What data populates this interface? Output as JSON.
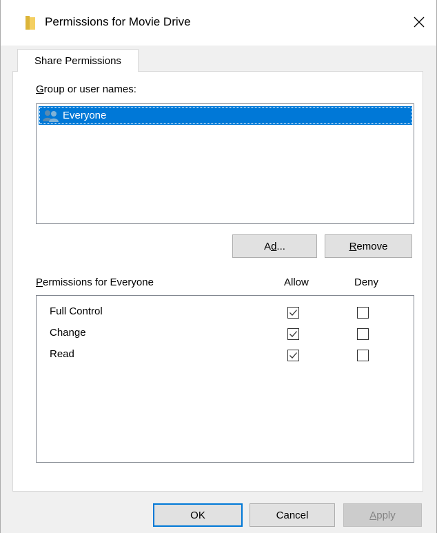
{
  "window": {
    "title": "Permissions for Movie Drive"
  },
  "tab": {
    "label": "Share Permissions"
  },
  "group_section": {
    "label_prefix": "",
    "label_hotkey": "G",
    "label_rest": "roup or user names:",
    "items": [
      {
        "name": "Everyone",
        "selected": true
      }
    ]
  },
  "buttons": {
    "add_hotkey_prefix": "A",
    "add_hotkey": "d",
    "add_rest": "d...",
    "remove_hotkey": "R",
    "remove_rest": "emove",
    "ok": "OK",
    "cancel": "Cancel",
    "apply_hotkey": "A",
    "apply_rest": "pply"
  },
  "permissions": {
    "label_hotkey": "P",
    "label_rest": "ermissions for Everyone",
    "allow_header": "Allow",
    "deny_header": "Deny",
    "rows": [
      {
        "name": "Full Control",
        "allow": true,
        "deny": false
      },
      {
        "name": "Change",
        "allow": true,
        "deny": false
      },
      {
        "name": "Read",
        "allow": true,
        "deny": false
      }
    ]
  },
  "colors": {
    "selection": "#0078d7",
    "default_button_border": "#0078d7"
  }
}
